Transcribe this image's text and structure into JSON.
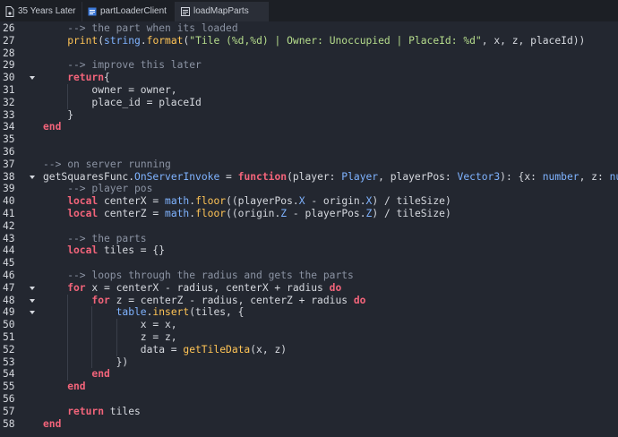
{
  "tabs": [
    {
      "label": "35 Years Later",
      "icon": "place-document-icon",
      "active": false,
      "closable": false
    },
    {
      "label": "partLoaderClient",
      "icon": "local-script-icon",
      "active": false,
      "closable": true
    },
    {
      "label": "loadMapParts",
      "icon": "server-script-icon",
      "active": true,
      "closable": false
    }
  ],
  "lines": [
    {
      "n": "26",
      "fold": false,
      "indent": 1,
      "tokens": [
        [
          "cm",
          "--> the part when its loaded"
        ]
      ]
    },
    {
      "n": "27",
      "fold": false,
      "indent": 1,
      "tokens": [
        [
          "fn",
          "print"
        ],
        [
          "op",
          "("
        ],
        [
          "bi",
          "string"
        ],
        [
          "op",
          "."
        ],
        [
          "fn",
          "format"
        ],
        [
          "op",
          "("
        ],
        [
          "str",
          "\"Tile (%d,%d) | Owner: Unoccupied | PlaceId: %d\""
        ],
        [
          "op",
          ", x, z, placeId))"
        ]
      ]
    },
    {
      "n": "28",
      "fold": false,
      "indent": 0,
      "tokens": []
    },
    {
      "n": "29",
      "fold": false,
      "indent": 1,
      "tokens": [
        [
          "cm",
          "--> improve this later"
        ]
      ]
    },
    {
      "n": "30",
      "fold": true,
      "indent": 1,
      "tokens": [
        [
          "kw",
          "return"
        ],
        [
          "op",
          "{"
        ]
      ]
    },
    {
      "n": "31",
      "fold": false,
      "indent": 2,
      "tokens": [
        [
          "op",
          "owner = owner,"
        ]
      ]
    },
    {
      "n": "32",
      "fold": false,
      "indent": 2,
      "tokens": [
        [
          "op",
          "place_id = placeId"
        ]
      ]
    },
    {
      "n": "33",
      "fold": false,
      "indent": 1,
      "tokens": [
        [
          "op",
          "}"
        ]
      ]
    },
    {
      "n": "34",
      "fold": false,
      "indent": 0,
      "tokens": [
        [
          "kw",
          "end"
        ]
      ]
    },
    {
      "n": "35",
      "fold": false,
      "indent": 0,
      "tokens": []
    },
    {
      "n": "36",
      "fold": false,
      "indent": 0,
      "tokens": []
    },
    {
      "n": "37",
      "fold": false,
      "indent": 0,
      "tokens": [
        [
          "cm",
          "--> on server running"
        ]
      ]
    },
    {
      "n": "38",
      "fold": true,
      "indent": 0,
      "tokens": [
        [
          "op",
          "getSquaresFunc."
        ],
        [
          "pr",
          "OnServerInvoke"
        ],
        [
          "op",
          " = "
        ],
        [
          "kw",
          "function"
        ],
        [
          "op",
          "(player: "
        ],
        [
          "tp",
          "Player"
        ],
        [
          "op",
          ", playerPos: "
        ],
        [
          "tp",
          "Vector3"
        ],
        [
          "op",
          "): {x: "
        ],
        [
          "tp",
          "number"
        ],
        [
          "op",
          ", z: "
        ],
        [
          "tp",
          "number"
        ]
      ]
    },
    {
      "n": "39",
      "fold": false,
      "indent": 1,
      "tokens": [
        [
          "cm",
          "--> player pos"
        ]
      ]
    },
    {
      "n": "40",
      "fold": false,
      "indent": 1,
      "tokens": [
        [
          "kw",
          "local"
        ],
        [
          "op",
          " centerX = "
        ],
        [
          "bi",
          "math"
        ],
        [
          "op",
          "."
        ],
        [
          "fn",
          "floor"
        ],
        [
          "op",
          "((playerPos."
        ],
        [
          "pr",
          "X"
        ],
        [
          "op",
          " - origin."
        ],
        [
          "pr",
          "X"
        ],
        [
          "op",
          ") / tileSize)"
        ]
      ]
    },
    {
      "n": "41",
      "fold": false,
      "indent": 1,
      "tokens": [
        [
          "kw",
          "local"
        ],
        [
          "op",
          " centerZ = "
        ],
        [
          "bi",
          "math"
        ],
        [
          "op",
          "."
        ],
        [
          "fn",
          "floor"
        ],
        [
          "op",
          "((origin."
        ],
        [
          "pr",
          "Z"
        ],
        [
          "op",
          " - playerPos."
        ],
        [
          "pr",
          "Z"
        ],
        [
          "op",
          ") / tileSize)"
        ]
      ]
    },
    {
      "n": "42",
      "fold": false,
      "indent": 0,
      "tokens": []
    },
    {
      "n": "43",
      "fold": false,
      "indent": 1,
      "tokens": [
        [
          "cm",
          "--> the parts"
        ]
      ]
    },
    {
      "n": "44",
      "fold": false,
      "indent": 1,
      "tokens": [
        [
          "kw",
          "local"
        ],
        [
          "op",
          " tiles = {}"
        ]
      ]
    },
    {
      "n": "45",
      "fold": false,
      "indent": 0,
      "tokens": []
    },
    {
      "n": "46",
      "fold": false,
      "indent": 1,
      "tokens": [
        [
          "cm",
          "--> loops through the radius and gets the parts"
        ]
      ]
    },
    {
      "n": "47",
      "fold": true,
      "indent": 1,
      "tokens": [
        [
          "kw",
          "for"
        ],
        [
          "op",
          " x = centerX - radius, centerX + radius "
        ],
        [
          "kw",
          "do"
        ]
      ]
    },
    {
      "n": "48",
      "fold": true,
      "indent": 2,
      "tokens": [
        [
          "kw",
          "for"
        ],
        [
          "op",
          " z = centerZ - radius, centerZ + radius "
        ],
        [
          "kw",
          "do"
        ]
      ]
    },
    {
      "n": "49",
      "fold": true,
      "indent": 3,
      "tokens": [
        [
          "bi",
          "table"
        ],
        [
          "op",
          "."
        ],
        [
          "fn",
          "insert"
        ],
        [
          "op",
          "(tiles, {"
        ]
      ]
    },
    {
      "n": "50",
      "fold": false,
      "indent": 4,
      "tokens": [
        [
          "op",
          "x = x,"
        ]
      ]
    },
    {
      "n": "51",
      "fold": false,
      "indent": 4,
      "tokens": [
        [
          "op",
          "z = z,"
        ]
      ]
    },
    {
      "n": "52",
      "fold": false,
      "indent": 4,
      "tokens": [
        [
          "op",
          "data = "
        ],
        [
          "fn",
          "getTileData"
        ],
        [
          "op",
          "(x, z)"
        ]
      ]
    },
    {
      "n": "53",
      "fold": false,
      "indent": 3,
      "tokens": [
        [
          "op",
          "})"
        ]
      ]
    },
    {
      "n": "54",
      "fold": false,
      "indent": 2,
      "tokens": [
        [
          "kw",
          "end"
        ]
      ]
    },
    {
      "n": "55",
      "fold": false,
      "indent": 1,
      "tokens": [
        [
          "kw",
          "end"
        ]
      ]
    },
    {
      "n": "56",
      "fold": false,
      "indent": 0,
      "tokens": []
    },
    {
      "n": "57",
      "fold": false,
      "indent": 1,
      "tokens": [
        [
          "kw",
          "return"
        ],
        [
          "op",
          " tiles"
        ]
      ]
    },
    {
      "n": "58",
      "fold": false,
      "indent": 0,
      "tokens": [
        [
          "kw",
          "end"
        ]
      ]
    }
  ]
}
